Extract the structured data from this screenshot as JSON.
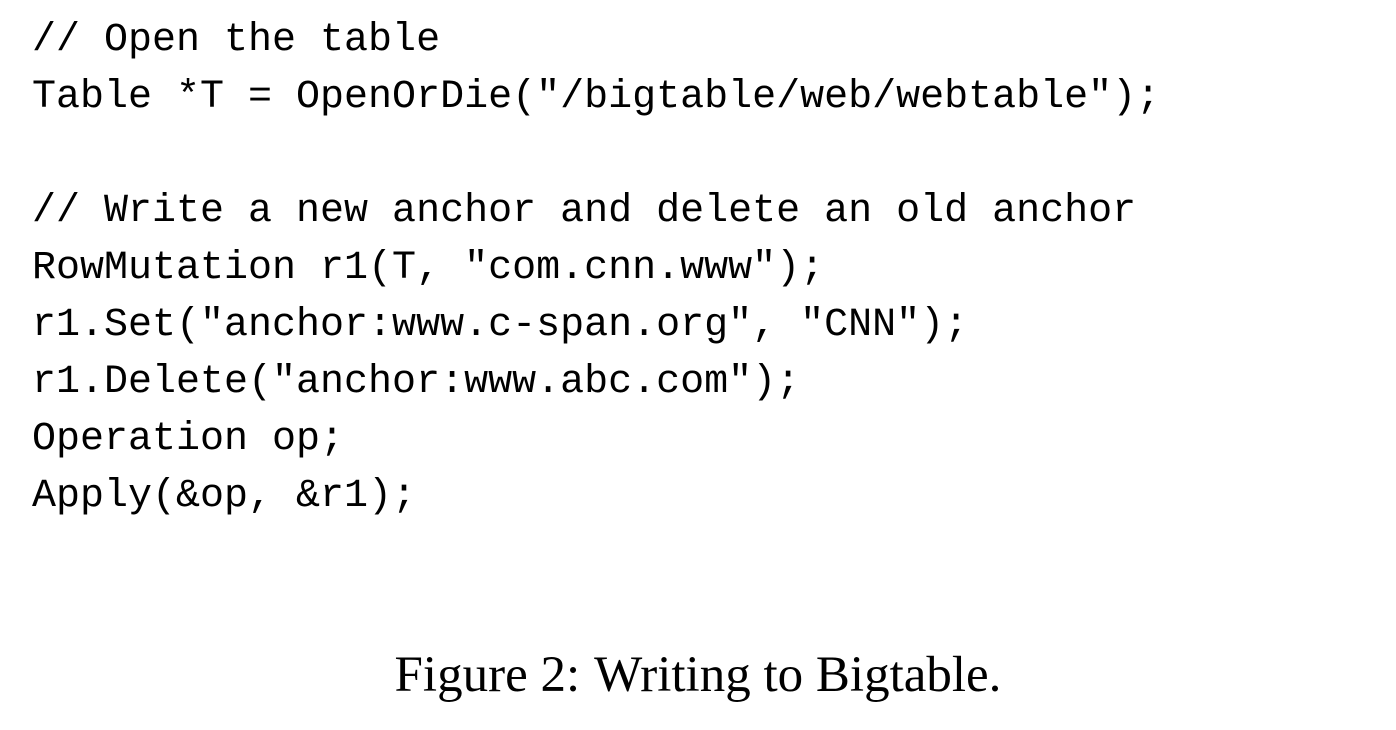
{
  "code": {
    "lines": [
      "// Open the table",
      "Table *T = OpenOrDie(\"/bigtable/web/webtable\");",
      "",
      "// Write a new anchor and delete an old anchor",
      "RowMutation r1(T, \"com.cnn.www\");",
      "r1.Set(\"anchor:www.c-span.org\", \"CNN\");",
      "r1.Delete(\"anchor:www.abc.com\");",
      "Operation op;",
      "Apply(&op, &r1);"
    ]
  },
  "caption": {
    "label": "Figure 2:",
    "text": "Writing to Bigtable."
  }
}
